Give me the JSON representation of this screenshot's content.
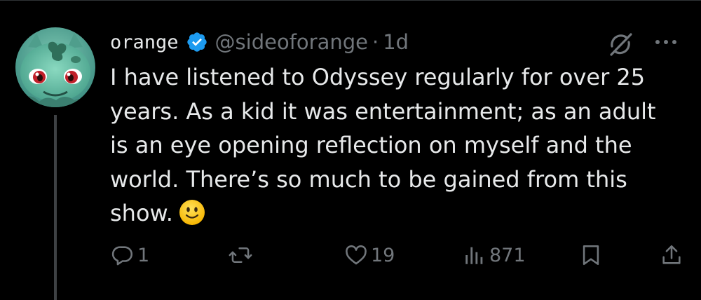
{
  "tweet": {
    "author": {
      "display_name": "orange",
      "handle": "@sideoforange",
      "verified": true,
      "avatar_icon": "bulbasaur-avatar"
    },
    "separator": "·",
    "time": "1d",
    "lines": [
      "I have listened to Odyssey regularly for over 25",
      "years. As a kid it was entertainment; as an adult",
      "is an eye opening reflection on myself and the",
      "world. There’s so much to be gained from this",
      "show."
    ],
    "emoji": "slightly-smiling-face"
  },
  "actions": {
    "replies": "1",
    "retweets": "",
    "likes": "19",
    "views": "871"
  },
  "colors": {
    "background": "#000000",
    "text": "#e7e9ea",
    "muted": "#71767b",
    "verified": "#1d9bf0",
    "thread_line": "#3e4144"
  }
}
